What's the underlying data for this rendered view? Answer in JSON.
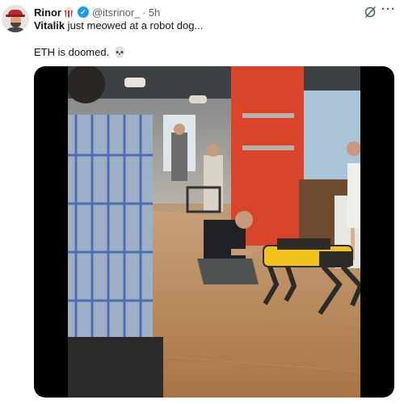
{
  "author": {
    "display_name": "Rinor",
    "name_emoji": "popcorn-icon",
    "verified": true,
    "handle": "@itsrinor_",
    "separator": "·",
    "time": "5h"
  },
  "tweet": {
    "mention_name": "Vitalik",
    "line1_rest": " just meowed at a robot dog...",
    "line2": "ETH is doomed.",
    "line2_emoji": "💀"
  },
  "actions": {
    "grok_icon": "grok-icon",
    "more_label": "···"
  },
  "media": {
    "type": "video",
    "description_icon": "video-frame"
  },
  "colors": {
    "text": "#0f1419",
    "secondary": "#536471",
    "verified": "#1d9bf0",
    "robot_yellow": "#f2c21b",
    "pillar_red": "#d9442b"
  }
}
